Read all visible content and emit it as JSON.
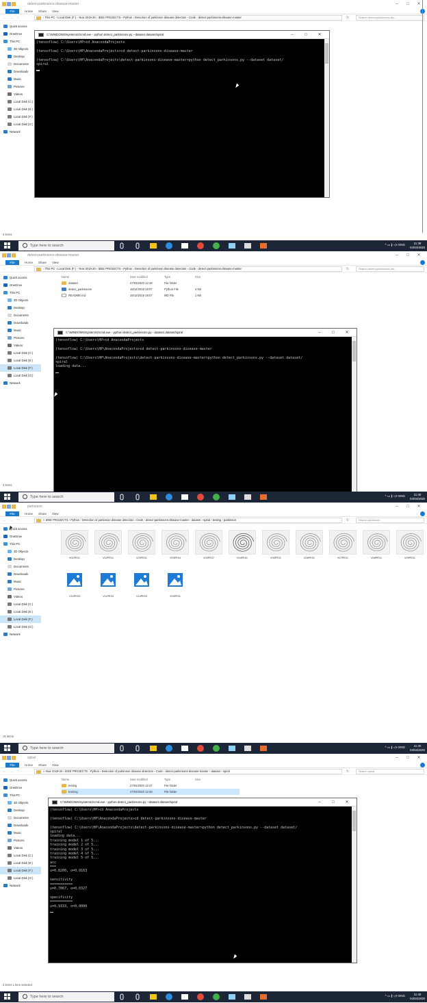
{
  "explorer": {
    "ribbon_tabs": [
      "File",
      "Home",
      "Share",
      "View"
    ],
    "window_controls": [
      "–",
      "□",
      "✕"
    ],
    "search_icon": "search-icon",
    "nav_items": [
      {
        "label": "Quick access",
        "icon": "star-icon",
        "color": "#2d7fd3"
      },
      {
        "label": "OneDrive",
        "icon": "cloud-icon",
        "color": "#1665bf"
      },
      {
        "label": "This PC",
        "icon": "computer-icon",
        "color": "#3d8fd8"
      },
      {
        "label": "3D Objects",
        "icon": "cube-icon",
        "color": "#6cb4ee"
      },
      {
        "label": "Desktop",
        "icon": "desktop-icon",
        "color": "#2a7cc7"
      },
      {
        "label": "Documents",
        "icon": "document-icon",
        "color": "#d6d6d6"
      },
      {
        "label": "Downloads",
        "icon": "download-icon",
        "color": "#2a7cc7"
      },
      {
        "label": "Music",
        "icon": "music-icon",
        "color": "#2a7cc7"
      },
      {
        "label": "Pictures",
        "icon": "picture-icon",
        "color": "#6fa3d8"
      },
      {
        "label": "Videos",
        "icon": "video-icon",
        "color": "#6b6b6b"
      },
      {
        "label": "Local Disk (C:)",
        "icon": "drive-icon",
        "color": "#7a7a7a"
      },
      {
        "label": "Local Disk (E:)",
        "icon": "drive-icon",
        "color": "#7a7a7a"
      },
      {
        "label": "Local Disk (F:)",
        "icon": "drive-icon",
        "color": "#7a7a7a"
      },
      {
        "label": "Local Disk (G:)",
        "icon": "drive-icon",
        "color": "#7a7a7a"
      },
      {
        "label": "Network",
        "icon": "network-icon",
        "color": "#2a7cc7"
      }
    ]
  },
  "panels": [
    {
      "window_title": "detect-parkinsons-disease-master",
      "breadcrumb": "› This PC › Local Disk (F:) › Year 2019-20 › IEEE PROJECTS › Python › Detection of parkinson disease detection › Code › detect-parkinsons-disease-master",
      "search_placeholder": "Search detect-parkinsons-dis...",
      "status": "3 items",
      "cmd_title": "C:\\WINDOWS\\system32\\cmd.exe - python  detect_parkinsons.py --dataset dataset/spiral",
      "cmd_lines": [
        "(tensoflow) C:\\Users\\HP>cd AnacondaProjects",
        "",
        "(tensoflow) C:\\Users\\HP\\AnacondaProjects>cd detect-parkinsons-disease-master",
        "",
        "(tensoflow) C:\\Users\\HP\\AnacondaProjects\\detect-parkinsons-disease-master>python detect_parkinsons.py --dataset dataset/",
        "spiral"
      ],
      "clock_time": "11:39",
      "clock_date": "04/04/2020"
    },
    {
      "window_title": "detect-parkinsons-disease-master",
      "breadcrumb": "› This PC › Local Disk (F:) › Year 2019-20 › IEEE PROJECTS › Python › Detection of parkinson disease detection › Code › detect-parkinsons-disease-master",
      "search_placeholder": "Search detect-parkinsons-dis...",
      "status": "3 items",
      "columns": [
        "Name",
        "Date modified",
        "Type",
        "Size"
      ],
      "files": [
        {
          "name": "dataset",
          "date": "27/03/2020 12:28",
          "type": "File folder",
          "size": "",
          "kind": "folder"
        },
        {
          "name": "detect_parkinsons",
          "date": "18/12/2019 19:07",
          "type": "Python File",
          "size": "4 KB",
          "kind": "py"
        },
        {
          "name": "README.md",
          "date": "18/12/2019 19:07",
          "type": "MD File",
          "size": "1 KB",
          "kind": "doc"
        }
      ],
      "cmd_title": "C:\\WINDOWS\\system32\\cmd.exe - python  detect_parkinsons.py --dataset dataset/spiral",
      "cmd_lines": [
        "(tensoflow) C:\\Users\\HP>cd AnacondaProjects",
        "",
        "(tensoflow) C:\\Users\\HP\\AnacondaProjects>cd detect-parkinsons-disease-master",
        "",
        "(tensoflow) C:\\Users\\HP\\AnacondaProjects\\detect-parkinsons-disease-master>python detect_parkinsons.py --dataset dataset/",
        "spiral",
        "loading data..."
      ],
      "clock_time": "11:40",
      "clock_date": "04/04/2020"
    },
    {
      "window_title": "parkinson",
      "breadcrumb": "« IEEE PROJECTS › Python › Detection of parkinson disease detection › Code › detect-parkinsons-disease-master › dataset › spiral › testing › parkinson",
      "search_placeholder": "Search parkinson",
      "status": "15 items",
      "thumbnails": [
        {
          "name": "V01PE01",
          "kind": "spiral"
        },
        {
          "name": "V02PE01",
          "kind": "spiral"
        },
        {
          "name": "V03PE01",
          "kind": "spiral"
        },
        {
          "name": "V03PE04",
          "kind": "spiral"
        },
        {
          "name": "V03PE07",
          "kind": "spiral"
        },
        {
          "name": "V04PE01",
          "kind": "spiral"
        },
        {
          "name": "V05PE01",
          "kind": "spiral"
        },
        {
          "name": "V06PE01",
          "kind": "spiral"
        },
        {
          "name": "V07PE01",
          "kind": "spiral"
        },
        {
          "name": "V08PE01",
          "kind": "spiral"
        },
        {
          "name": "V09PE01",
          "kind": "spiral"
        },
        {
          "name": "V10PE03",
          "kind": "image"
        },
        {
          "name": "V11PE03",
          "kind": "image"
        },
        {
          "name": "V14PE03",
          "kind": "image"
        },
        {
          "name": "V15PE01",
          "kind": "image"
        }
      ],
      "clock_time": "11:40",
      "clock_date": "04/04/2020"
    },
    {
      "window_title": "spiral",
      "breadcrumb": "« Year 2019-20 › IEEE PROJECTS › Python › Detection of parkinson disease detection › Code › detect-parkinsons-disease-master › dataset › spiral",
      "search_placeholder": "Search spiral",
      "status": "2 items    1 item selected",
      "columns": [
        "Name",
        "Date modified",
        "Type",
        "Size"
      ],
      "files": [
        {
          "name": "testing",
          "date": "27/03/2020 12:27",
          "type": "File folder",
          "size": "",
          "kind": "folder"
        },
        {
          "name": "training",
          "date": "27/03/2020 12:28",
          "type": "File folder",
          "size": "",
          "kind": "folder",
          "selected": true
        }
      ],
      "cmd_title": "C:\\WINDOWS\\system32\\cmd.exe - python  detect_parkinsons.py --dataset dataset/spiral",
      "cmd_lines": [
        "(tensoflow) C:\\Users\\HP>cd AnacondaProjects",
        "",
        "(tensoflow) C:\\Users\\HP\\AnacondaProjects>cd detect-parkinsons-disease-master",
        "",
        "(tensoflow) C:\\Users\\HP\\AnacondaProjects\\detect-parkinsons-disease-master>python detect_parkinsons.py --dataset dataset/",
        "spiral",
        "loading data...",
        "training model 1 of 5...",
        "training model 2 of 5...",
        "training model 3 of 5...",
        "training model 4 of 5...",
        "training model 5 of 5...",
        "acc",
        "===",
        "u=0.8200, o=0.0163",
        "",
        "sensitivity",
        "===========",
        "u=0.7067, o=0.0327",
        "",
        "specificity",
        "===========",
        "u=0.9333, o=0.0000"
      ],
      "clock_time": "11:40",
      "clock_date": "04/04/2020"
    }
  ],
  "taskbar": {
    "search_placeholder": "Type here to search",
    "tray_text": "^  ▭  ∦  ◁×  ENG",
    "apps": [
      {
        "icon": "microphone-icon",
        "color": "#ffffff"
      },
      {
        "icon": "task-view-icon",
        "color": "#ffffff"
      },
      {
        "icon": "file-explorer-icon",
        "color": "#f0c419"
      },
      {
        "icon": "edge-icon",
        "color": "#2e8cde"
      },
      {
        "icon": "store-icon",
        "color": "#ffffff"
      },
      {
        "icon": "chrome-icon",
        "color": "#e24b3b"
      },
      {
        "icon": "anaconda-icon",
        "color": "#44b04a"
      },
      {
        "icon": "notepad-icon",
        "color": "#8fd0f4"
      },
      {
        "icon": "terminal-icon",
        "color": "#dddddd"
      },
      {
        "icon": "app-icon",
        "color": "#e86d2f"
      }
    ]
  }
}
